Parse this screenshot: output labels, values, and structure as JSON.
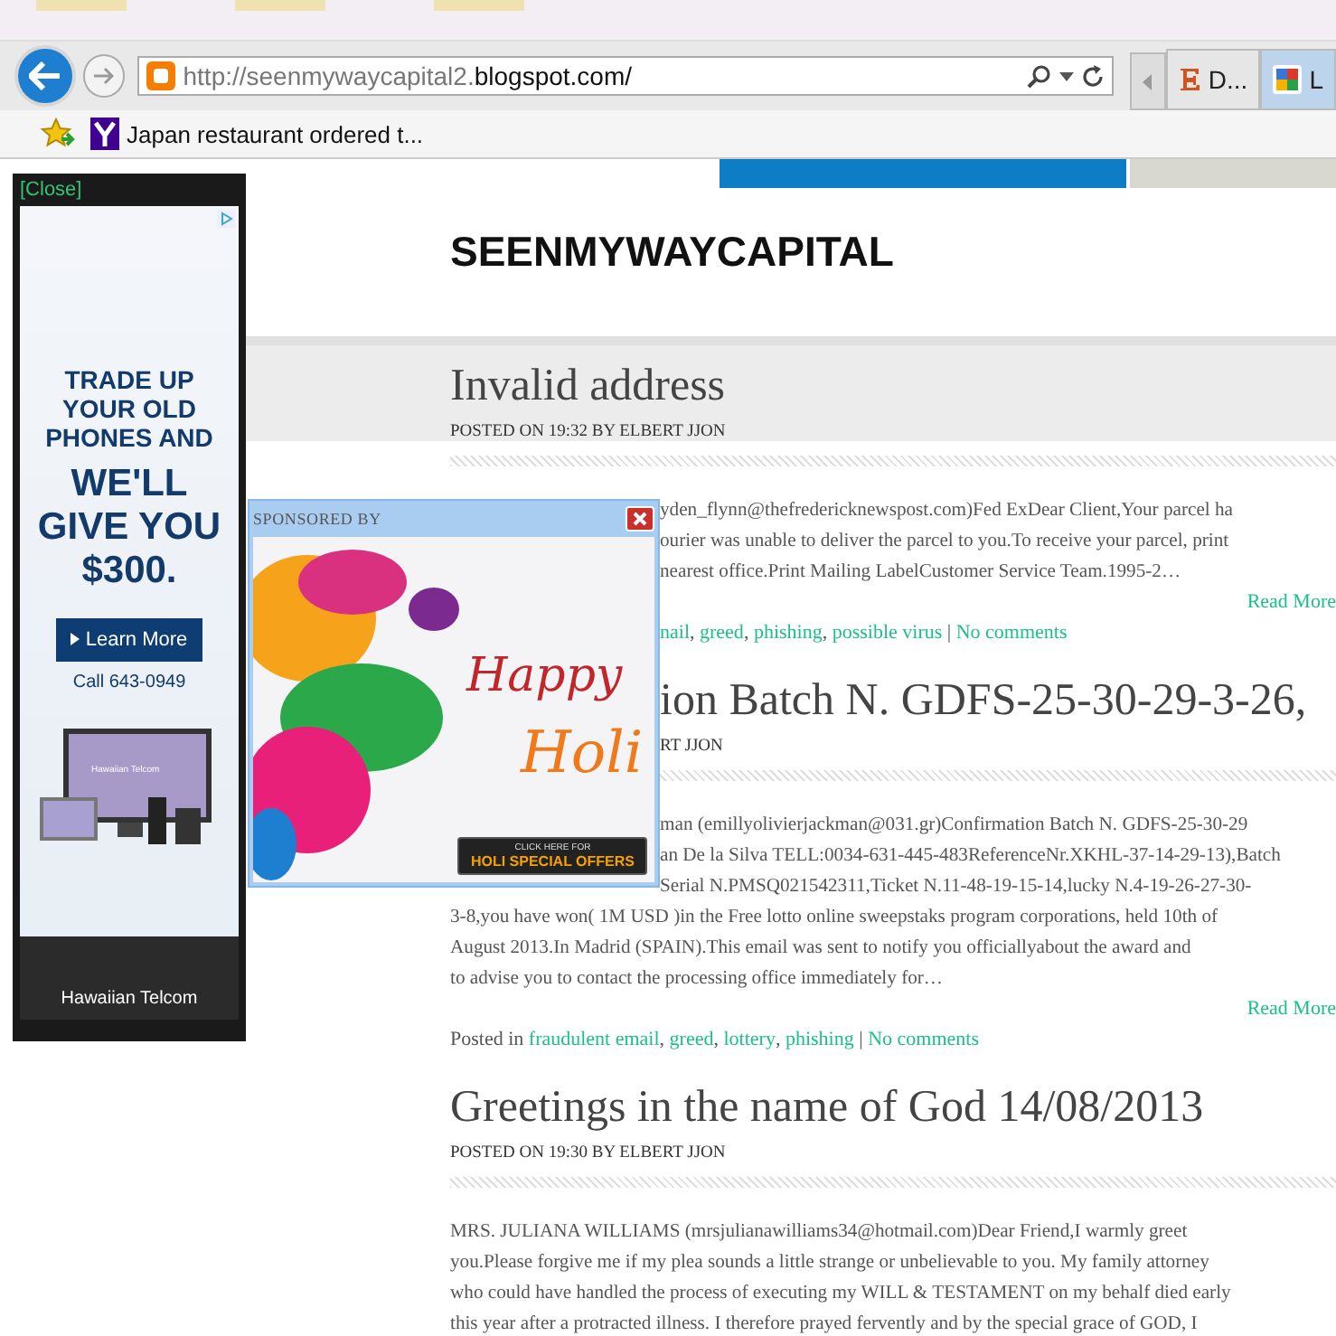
{
  "browser": {
    "url_dim": "http://seenmywaycapital2.",
    "url_main": "blogspot.com/",
    "tabs": [
      {
        "label": "D...",
        "selected": false
      },
      {
        "label": "L",
        "selected": true
      }
    ],
    "favorites": [
      {
        "label": "Japan restaurant ordered t..."
      }
    ]
  },
  "ad": {
    "close": "[Close]",
    "headline": "TRADE UP YOUR OLD PHONES AND",
    "offer": "WE'LL GIVE YOU $300.",
    "button": "Learn More",
    "phone": "Call 643-0949",
    "screen_brand": "Hawaiian Telcom",
    "brand": "Hawaiian Telcom"
  },
  "site": {
    "title": "SEENMYWAYCAPITAL"
  },
  "posts": [
    {
      "title": "Invalid address",
      "title_hidden_part": false,
      "meta": "POSTED ON 19:32 BY ELBERT JJON",
      "meta_hidden_part": false,
      "lines": [
        {
          "text": "yden_flynn@thefredericknewspost.com)Fed ExDear Client,Your parcel ha",
          "partly_hidden": true
        },
        {
          "text": "ourier was unable to deliver the parcel to you.To receive your parcel, print",
          "partly_hidden": true
        },
        {
          "text": "nearest office.Print Mailing LabelCustomer Service Team.1995-2…",
          "partly_hidden": true
        }
      ],
      "read_more": "Read More",
      "footer": {
        "partly_hidden": true,
        "comma": ",",
        "divider": "|",
        "tags": [
          "nail",
          "greed",
          "phishing",
          "possible virus"
        ],
        "comments": "No comments"
      }
    },
    {
      "title": "ion Batch N. GDFS-25-30-29-3-26,",
      "title_hidden_part": true,
      "meta": "RT JJON",
      "meta_hidden_part": true,
      "lines": [
        {
          "text": "man (emillyolivierjackman@031.gr)Confirmation Batch N. GDFS-25-30-29",
          "partly_hidden": true
        },
        {
          "text": "an De la Silva TELL:0034-631-445-483ReferenceNr.XKHL-37-14-29-13),Batch",
          "partly_hidden": true
        },
        {
          "text": "Serial N.PMSQ021542311,Ticket N.11-48-19-15-14,lucky N.4-19-26-27-30-",
          "partly_hidden": true
        },
        {
          "text": "3-8,you have won( 1M USD )in the Free lotto online sweepstaks program corporations, held 10th of",
          "partly_hidden": false
        },
        {
          "text": "August 2013.In Madrid (SPAIN).This email was sent to notify you officiallyabout the award and",
          "partly_hidden": false
        },
        {
          "text": "to advise you to contact the processing office immediately for…",
          "partly_hidden": false
        }
      ],
      "read_more": "Read More",
      "footer": {
        "partly_hidden": false,
        "comma": ",",
        "divider": "|",
        "prefix": "Posted in",
        "tags": [
          "fraudulent email",
          "greed",
          "lottery",
          "phishing"
        ],
        "comments": "No comments"
      }
    },
    {
      "title": "Greetings in the name of God 14/08/2013",
      "title_hidden_part": false,
      "meta": "POSTED ON 19:30 BY ELBERT JJON",
      "meta_hidden_part": false,
      "lines": [
        {
          "text": "MRS. JULIANA WILLIAMS (mrsjulianawilliams34@hotmail.com)Dear Friend,I warmly greet",
          "partly_hidden": false
        },
        {
          "text": "you.Please forgive me if my plea sounds a little strange or unbelievable to you. My family attorney",
          "partly_hidden": false
        },
        {
          "text": "who could have handled the process of executing my WILL & TESTAMENT on my behalf died early",
          "partly_hidden": false
        },
        {
          "text": "this year after a protracted illness. I therefore prayed fervently and by the special grace of GOD, I",
          "partly_hidden": false
        }
      ]
    }
  ],
  "popup": {
    "label": "SPONSORED BY",
    "greeting_1": "Happy",
    "greeting_2": "Holi",
    "cta_small": "CLICK HERE FOR",
    "cta": "HOLI SPECIAL OFFERS"
  }
}
